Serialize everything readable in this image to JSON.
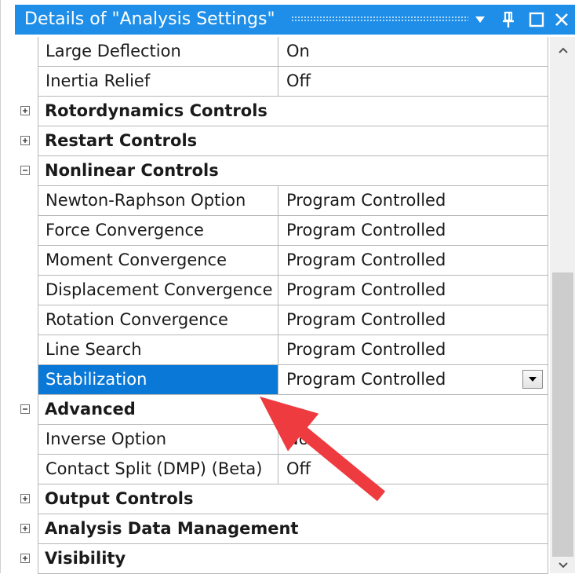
{
  "window": {
    "title": "Details of \"Analysis Settings\"",
    "title_color": "#1e8ee8",
    "icons": [
      "dropdown-triangle-icon",
      "pin-icon",
      "maximize-icon",
      "close-icon"
    ]
  },
  "rows": [
    {
      "type": "prop",
      "label": "Large Deflection",
      "value": "On"
    },
    {
      "type": "prop",
      "label": "Inertia Relief",
      "value": "Off"
    },
    {
      "type": "group",
      "label": "Rotordynamics Controls",
      "expanded": false
    },
    {
      "type": "group",
      "label": "Restart Controls",
      "expanded": false
    },
    {
      "type": "group",
      "label": "Nonlinear Controls",
      "expanded": true
    },
    {
      "type": "prop",
      "label": "Newton-Raphson Option",
      "value": "Program Controlled"
    },
    {
      "type": "prop",
      "label": "Force Convergence",
      "value": "Program Controlled"
    },
    {
      "type": "prop",
      "label": "Moment Convergence",
      "value": "Program Controlled"
    },
    {
      "type": "prop",
      "label": "Displacement Convergence",
      "value": "Program Controlled"
    },
    {
      "type": "prop",
      "label": "Rotation Convergence",
      "value": "Program Controlled"
    },
    {
      "type": "prop",
      "label": "Line Search",
      "value": "Program Controlled"
    },
    {
      "type": "prop",
      "label": "Stabilization",
      "value": "Program Controlled",
      "selected": true,
      "dropdown": true
    },
    {
      "type": "group",
      "label": "Advanced",
      "expanded": true
    },
    {
      "type": "prop",
      "label": "Inverse Option",
      "value": "No"
    },
    {
      "type": "prop",
      "label": "Contact Split (DMP) (Beta)",
      "value": "Off"
    },
    {
      "type": "group",
      "label": "Output Controls",
      "expanded": false
    },
    {
      "type": "group",
      "label": "Analysis Data Management",
      "expanded": false
    },
    {
      "type": "group",
      "label": "Visibility",
      "expanded": false
    }
  ],
  "colors": {
    "selection": "#0a78d7",
    "annotation_arrow": "#ee3b3f"
  }
}
